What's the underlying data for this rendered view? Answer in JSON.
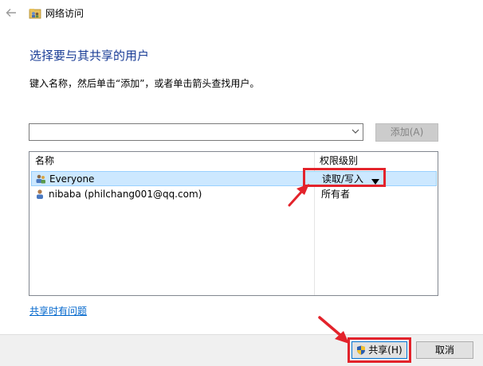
{
  "window": {
    "title": "网络访问"
  },
  "heading": "选择要与其共享的用户",
  "instruction": "键入名称，然后单击“添加”，或者单击箭头查找用户。",
  "user_input": {
    "value": ""
  },
  "add_button": {
    "label": "添加(A)",
    "enabled": false
  },
  "user_table": {
    "columns": [
      "名称",
      "权限级别"
    ],
    "rows": [
      {
        "name": "Everyone",
        "permission": "读取/写入",
        "selected": true,
        "icon": "user-group-icon"
      },
      {
        "name": "nibaba (philchang001@qq.com)",
        "permission": "所有者",
        "selected": false,
        "icon": "user-icon"
      }
    ]
  },
  "help_link": "共享时有问题",
  "footer": {
    "share_label": "共享(H)",
    "cancel_label": "取消"
  },
  "colors": {
    "heading": "#1a3d96",
    "selection": "#cce8ff",
    "annotation": "#e3232b",
    "link": "#0066cc"
  }
}
